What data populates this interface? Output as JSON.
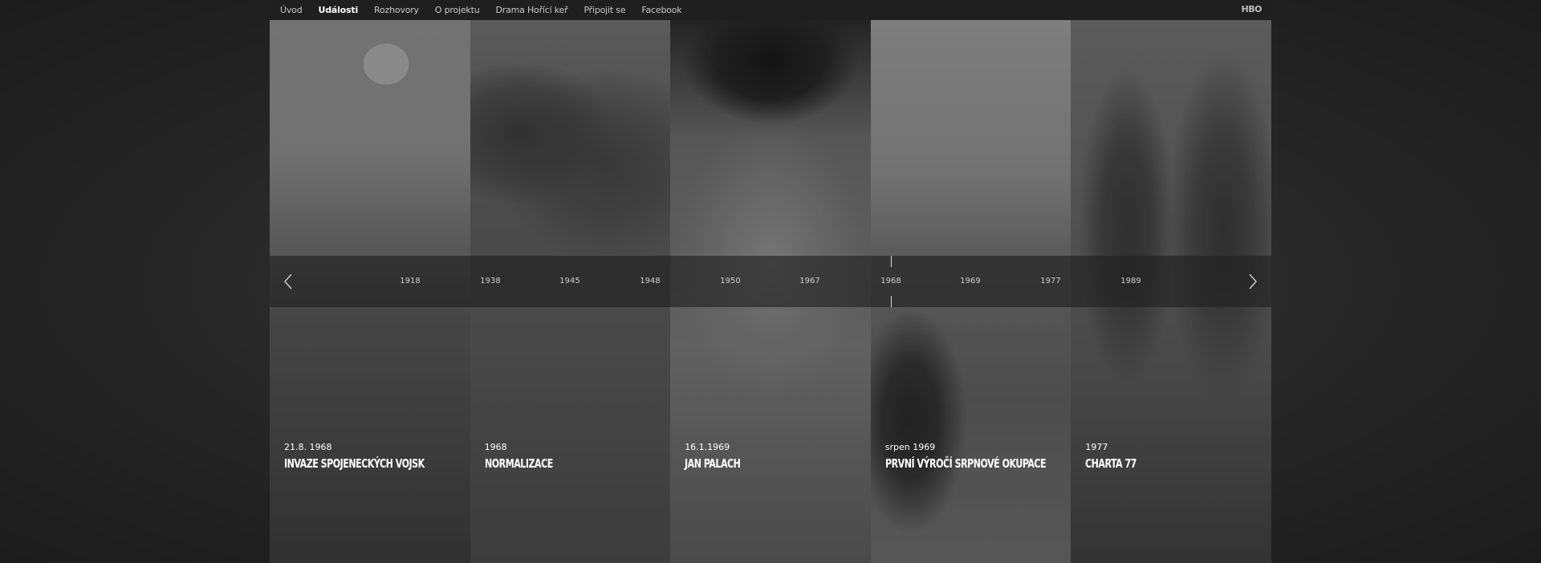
{
  "nav": {
    "items": [
      {
        "label": "Úvod",
        "active": false
      },
      {
        "label": "Události",
        "active": true
      },
      {
        "label": "Rozhovory",
        "active": false
      },
      {
        "label": "O projektu",
        "active": false
      },
      {
        "label": "Drama Hořící keř",
        "active": false
      },
      {
        "label": "Připojit se",
        "active": false
      },
      {
        "label": "Facebook",
        "active": false
      }
    ],
    "brand": "HBO"
  },
  "events": [
    {
      "date": "21.8. 1968",
      "title": "Invaze spojeneckých vojsk"
    },
    {
      "date": "1968",
      "title": "Normalizace"
    },
    {
      "date": "16.1.1969",
      "title": "Jan Palach"
    },
    {
      "date": "srpen 1969",
      "title": "První výročí srpnové okupace"
    },
    {
      "date": "1977",
      "title": "Charta 77"
    }
  ],
  "timeline": {
    "years": [
      "1918",
      "1938",
      "1945",
      "1948",
      "1950",
      "1967",
      "1968",
      "1969",
      "1977",
      "1989"
    ],
    "selected": "1968",
    "prev_icon": "chevron-left-icon",
    "next_icon": "chevron-right-icon"
  },
  "colors": {
    "nav_bg": "#1f1f1f",
    "page_bg": "#262626",
    "text": "#ffffff"
  }
}
